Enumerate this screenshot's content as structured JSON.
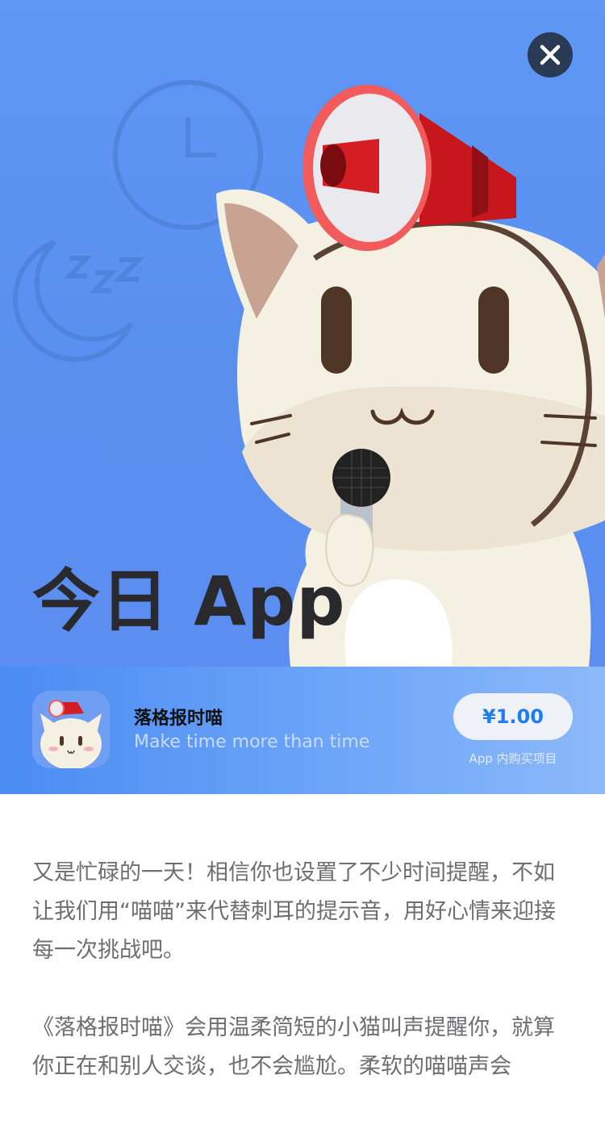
{
  "header": {
    "title": "今日 App",
    "close_icon": "close-icon"
  },
  "app_card": {
    "icon": "cat-megaphone-app-icon",
    "name": "落格报时喵",
    "subtitle": "Make time more than time",
    "price": "¥1.00",
    "iap_note": "App 内购买项目"
  },
  "article": {
    "paragraphs": [
      "又是忙碌的一天！相信你也设置了不少时间提醒，不如让我们用“喵喵”来代替刺耳的提示音，用好心情来迎接每一次挑战吧。",
      "《落格报时喵》会用温柔简短的小猫叫声提醒你，就算你正在和别人交谈，也不会尴尬。柔软的喵喵声会"
    ]
  },
  "colors": {
    "hero_background": "#5f97f5",
    "price_text": "#1f7cf3",
    "close_button": "#2c3b55"
  }
}
